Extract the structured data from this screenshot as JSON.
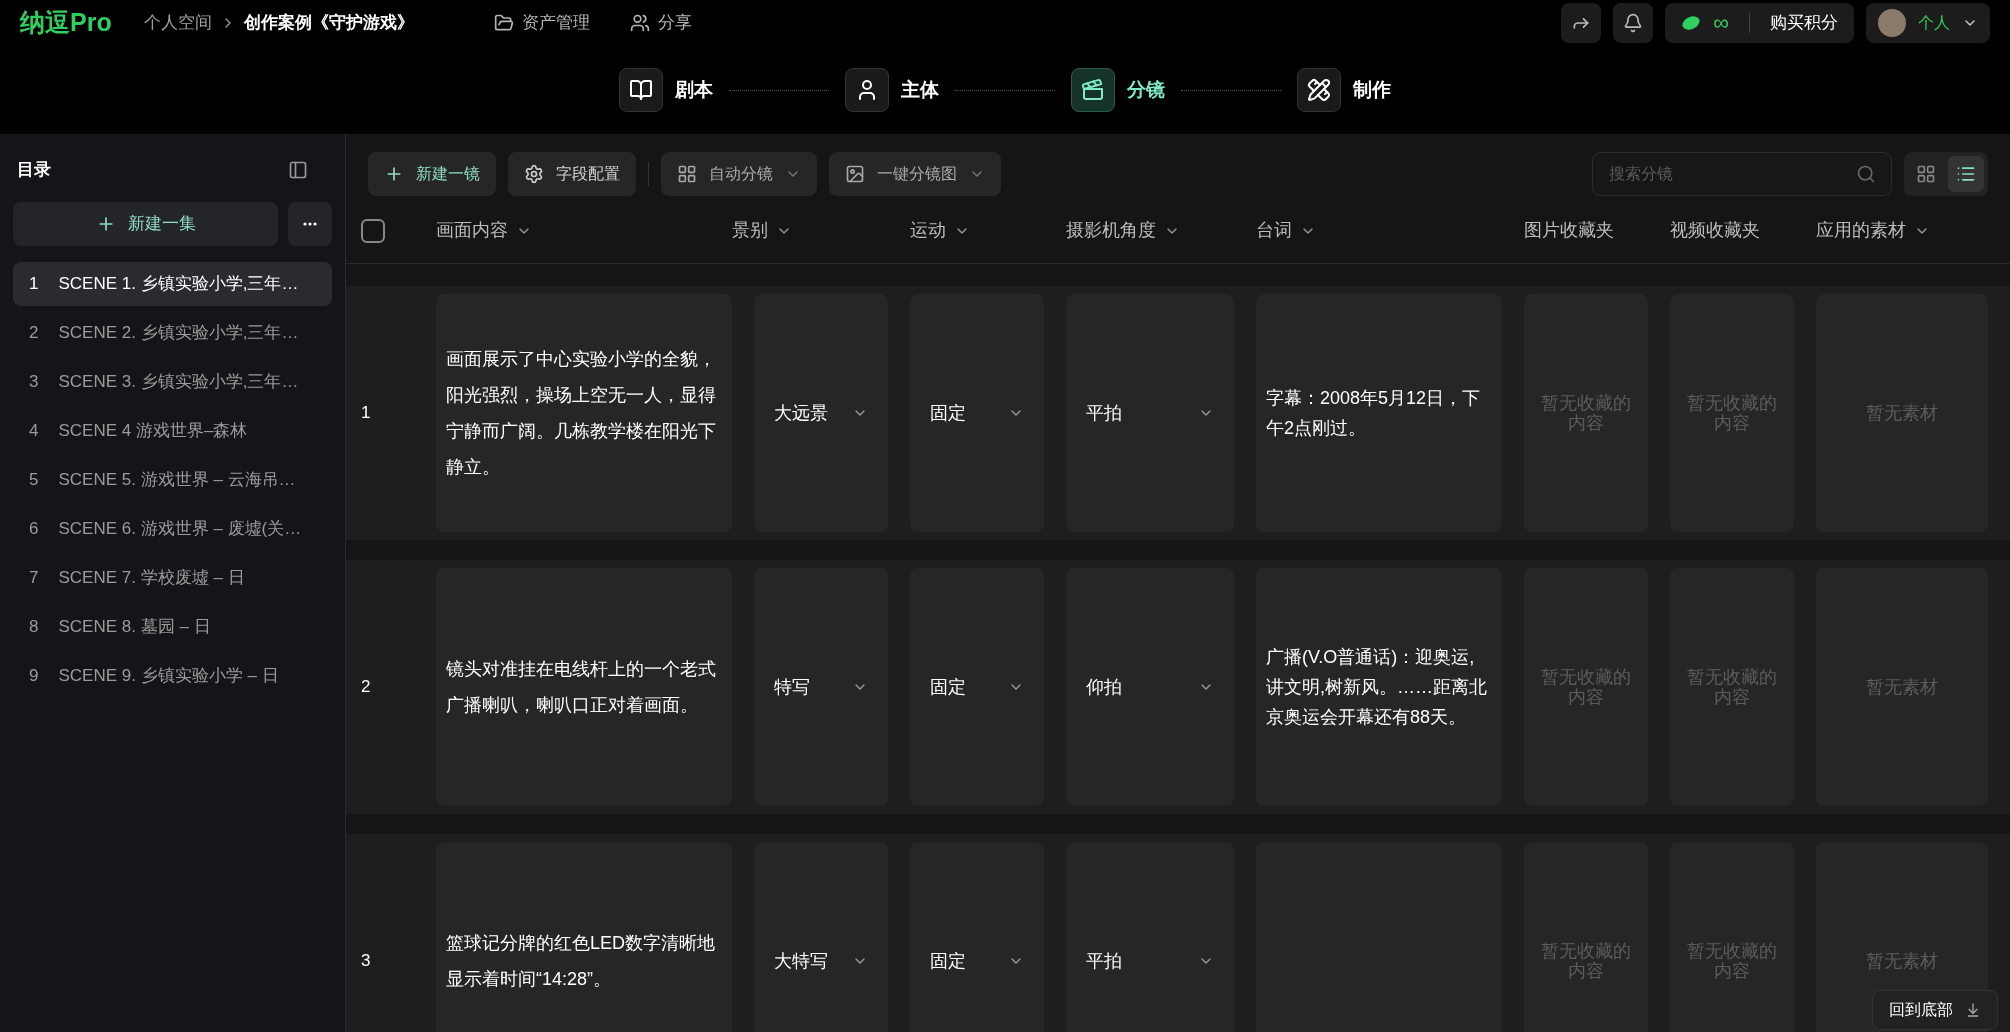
{
  "topbar": {
    "logo": "纳逗Pro",
    "breadcrumb": [
      {
        "label": "个人空间",
        "current": false
      },
      {
        "label": "创作案例《守护游戏》",
        "current": true
      }
    ],
    "nav": [
      {
        "kind": "folder",
        "label": "资产管理"
      },
      {
        "kind": "people",
        "label": "分享"
      }
    ],
    "credits": "∞",
    "buy": "购买积分",
    "user": "个人"
  },
  "steps": [
    {
      "kind": "book",
      "label": "剧本",
      "selected": false
    },
    {
      "kind": "person",
      "label": "主体",
      "selected": false
    },
    {
      "kind": "clapper",
      "label": "分镜",
      "selected": true
    },
    {
      "kind": "tools",
      "label": "制作",
      "selected": false
    }
  ],
  "sidebar": {
    "title": "目录",
    "new_button": "新建一集",
    "episodes": [
      {
        "number": "1",
        "title": "SCENE 1. 乡镇实验小学,三年…",
        "selected": true
      },
      {
        "number": "2",
        "title": "SCENE 2. 乡镇实验小学,三年…",
        "selected": false
      },
      {
        "number": "3",
        "title": "SCENE 3. 乡镇实验小学,三年…",
        "selected": false
      },
      {
        "number": "4",
        "title": "SCENE 4 游戏世界–森林",
        "selected": false
      },
      {
        "number": "5",
        "title": "SCENE 5. 游戏世界 – 云海吊…",
        "selected": false
      },
      {
        "number": "6",
        "title": "SCENE 6. 游戏世界 – 废墟(关…",
        "selected": false
      },
      {
        "number": "7",
        "title": "SCENE 7. 学校废墟 – 日",
        "selected": false
      },
      {
        "number": "8",
        "title": "SCENE 8. 墓园 – 日",
        "selected": false
      },
      {
        "number": "9",
        "title": "SCENE 9. 乡镇实验小学 – 日",
        "selected": false
      }
    ]
  },
  "toolbar": [
    {
      "kind": "add",
      "label": "新建一镜"
    },
    {
      "kind": "settings",
      "label": "字段配置"
    },
    {
      "kind": "grid",
      "label": "自动分镜"
    },
    {
      "kind": "image",
      "label": "一键分镜图"
    }
  ],
  "search": {
    "placeholder": "搜索分镜"
  },
  "views": [
    {
      "kind": "grid",
      "selected": false
    },
    {
      "kind": "list",
      "selected": true
    }
  ],
  "select_all": {
    "checked": false
  },
  "columns": [
    {
      "label": "画面内容",
      "dropdown": true
    },
    {
      "label": "景别",
      "dropdown": true
    },
    {
      "label": "运动",
      "dropdown": true
    },
    {
      "label": "摄影机角度",
      "dropdown": true
    },
    {
      "label": "台词",
      "dropdown": true
    },
    {
      "label": "图片收藏夹",
      "dropdown": false
    },
    {
      "label": "视频收藏夹",
      "dropdown": false
    },
    {
      "label": "应用的素材",
      "dropdown": true
    }
  ],
  "rows": [
    {
      "number": "1",
      "content": "画面展示了中心实验小学的全貌，阳光强烈，操场上空无一人，显得宁静而广阔。几栋教学楼在阳光下静立。",
      "shot_size": "大远景",
      "movement": "固定",
      "angle": "平拍",
      "dialogue": "字幕：2008年5月12日，下午2点刚过。",
      "picture_folder": "暂无收藏的内容",
      "video_folder": "暂无收藏的内容",
      "assets": "暂无素材"
    },
    {
      "number": "2",
      "content": "镜头对准挂在电线杆上的一个老式广播喇叭，喇叭口正对着画面。",
      "shot_size": "特写",
      "movement": "固定",
      "angle": "仰拍",
      "dialogue": "广播(V.O普通话)：迎奥运,讲文明,树新风。……距离北京奥运会开幕还有88天。",
      "picture_folder": "暂无收藏的内容",
      "video_folder": "暂无收藏的内容",
      "assets": "暂无素材"
    },
    {
      "number": "3",
      "content": "篮球记分牌的红色LED数字清晰地显示着时间“14:28”。",
      "shot_size": "大特写",
      "movement": "固定",
      "angle": "平拍",
      "picture_folder": "暂无收藏的内容",
      "video_folder": "暂无收藏的内容",
      "assets": "暂无素材"
    }
  ],
  "floating_button": "回到底部"
}
